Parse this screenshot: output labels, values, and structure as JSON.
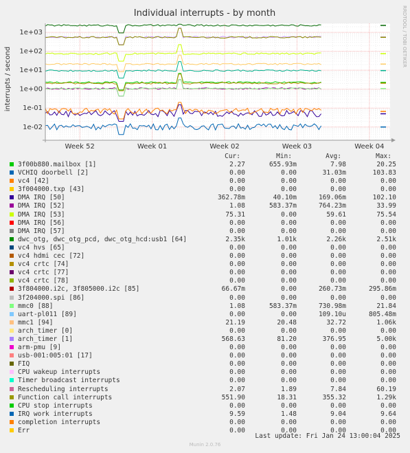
{
  "chart_data": {
    "type": "line",
    "title": "Individual interrupts - by month",
    "ylabel": "interrupts / second",
    "y_scale": "log",
    "ylim": [
      0.002,
      3000
    ],
    "y_ticks": [
      {
        "value": 1000,
        "label": "1e+03"
      },
      {
        "value": 100,
        "label": "1e+02"
      },
      {
        "value": 10,
        "label": "1e+01"
      },
      {
        "value": 1,
        "label": "1e+00"
      },
      {
        "value": 0.1,
        "label": "1e-01"
      },
      {
        "value": 0.01,
        "label": "1e-02"
      }
    ],
    "x_ticks": [
      "Week 52",
      "Week 01",
      "Week 02",
      "Week 03",
      "Week 04"
    ],
    "grid": true,
    "series": [
      {
        "name": "3f00b880.mailbox [1]",
        "color": "#00cc00",
        "level": 2.27
      },
      {
        "name": "VCHIQ doorbell [2]",
        "color": "#0066b3",
        "level": 0.01
      },
      {
        "name": "DMA IRQ [50]",
        "color": "#330099",
        "level": 0.05
      },
      {
        "name": "DMA IRQ [52]",
        "color": "#990099",
        "level": 1.08
      },
      {
        "name": "DMA IRQ [53]",
        "color": "#ccff00",
        "level": 75.31
      },
      {
        "name": "dwc_otg, dwc_otg_pcd, dwc_otg_hcd:usb1 [64]",
        "color": "#006600",
        "level": 2350
      },
      {
        "name": "3f804000.i2c, 3f805000.i2c [85]",
        "color": "#ff8000",
        "level": 0.0667
      },
      {
        "name": "mmc0 [88]",
        "color": "#8fff8f",
        "level": 1.08
      },
      {
        "name": "mmc1 [94]",
        "color": "#ffcc66",
        "level": 21.19
      },
      {
        "name": "arch_timer [1]",
        "color": "#cc99ff",
        "level": 568.63
      },
      {
        "name": "Rescheduling interrupts",
        "color": "#b38f00",
        "level": 2.07
      },
      {
        "name": "Function call interrupts",
        "color": "#8f8f00",
        "level": 551.9
      },
      {
        "name": "IRQ work interrupts",
        "color": "#00b38f",
        "level": 9.59
      }
    ]
  },
  "side_text": "RRDTOOL / TOBI OETIKER",
  "legend_headers": {
    "cur": "Cur:",
    "min": "Min:",
    "avg": "Avg:",
    "max": "Max:"
  },
  "legend": [
    {
      "name": "3f00b880.mailbox [1]",
      "color": "#00cc00",
      "cur": "2.27",
      "min": "655.93m",
      "avg": "7.98",
      "max": "20.25"
    },
    {
      "name": "VCHIQ doorbell [2]",
      "color": "#0066b3",
      "cur": "0.00",
      "min": "0.00",
      "avg": "31.03m",
      "max": "103.83"
    },
    {
      "name": "vc4 [42]",
      "color": "#ff8000",
      "cur": "0.00",
      "min": "0.00",
      "avg": "0.00",
      "max": "0.00"
    },
    {
      "name": "3f004000.txp [43]",
      "color": "#ffcc00",
      "cur": "0.00",
      "min": "0.00",
      "avg": "0.00",
      "max": "0.00"
    },
    {
      "name": "DMA IRQ [50]",
      "color": "#330099",
      "cur": "362.78m",
      "min": "40.10m",
      "avg": "169.06m",
      "max": "102.10"
    },
    {
      "name": "DMA IRQ [52]",
      "color": "#990099",
      "cur": "1.08",
      "min": "583.37m",
      "avg": "764.23m",
      "max": "33.99"
    },
    {
      "name": "DMA IRQ [53]",
      "color": "#ccff00",
      "cur": "75.31",
      "min": "0.00",
      "avg": "59.61",
      "max": "75.54"
    },
    {
      "name": "DMA IRQ [56]",
      "color": "#ff0000",
      "cur": "0.00",
      "min": "0.00",
      "avg": "0.00",
      "max": "0.00"
    },
    {
      "name": "DMA IRQ [57]",
      "color": "#808080",
      "cur": "0.00",
      "min": "0.00",
      "avg": "0.00",
      "max": "0.00"
    },
    {
      "name": "dwc_otg, dwc_otg_pcd, dwc_otg_hcd:usb1 [64]",
      "color": "#008f00",
      "cur": "2.35k",
      "min": "1.01k",
      "avg": "2.26k",
      "max": "2.51k"
    },
    {
      "name": "vc4 hvs [65]",
      "color": "#00487d",
      "cur": "0.00",
      "min": "0.00",
      "avg": "0.00",
      "max": "0.00"
    },
    {
      "name": "vc4 hdmi cec [72]",
      "color": "#b35a00",
      "cur": "0.00",
      "min": "0.00",
      "avg": "0.00",
      "max": "0.00"
    },
    {
      "name": "vc4 crtc [74]",
      "color": "#b38f00",
      "cur": "0.00",
      "min": "0.00",
      "avg": "0.00",
      "max": "0.00"
    },
    {
      "name": "vc4 crtc [77]",
      "color": "#6b006b",
      "cur": "0.00",
      "min": "0.00",
      "avg": "0.00",
      "max": "0.00"
    },
    {
      "name": "vc4 crtc [78]",
      "color": "#8fb300",
      "cur": "0.00",
      "min": "0.00",
      "avg": "0.00",
      "max": "0.00"
    },
    {
      "name": "3f804000.i2c, 3f805000.i2c [85]",
      "color": "#b30000",
      "cur": "66.67m",
      "min": "0.00",
      "avg": "260.73m",
      "max": "295.86m"
    },
    {
      "name": "3f204000.spi [86]",
      "color": "#bebebe",
      "cur": "0.00",
      "min": "0.00",
      "avg": "0.00",
      "max": "0.00"
    },
    {
      "name": "mmc0 [88]",
      "color": "#80ff80",
      "cur": "1.08",
      "min": "583.37m",
      "avg": "730.98m",
      "max": "21.84"
    },
    {
      "name": "uart-pl011 [89]",
      "color": "#80c9ff",
      "cur": "0.00",
      "min": "0.00",
      "avg": "109.10u",
      "max": "805.48m"
    },
    {
      "name": "mmc1 [94]",
      "color": "#ffc080",
      "cur": "21.19",
      "min": "20.48",
      "avg": "32.72",
      "max": "1.06k"
    },
    {
      "name": "arch_timer [0]",
      "color": "#ffe680",
      "cur": "0.00",
      "min": "0.00",
      "avg": "0.00",
      "max": "0.00"
    },
    {
      "name": "arch_timer [1]",
      "color": "#aa80ff",
      "cur": "568.63",
      "min": "81.20",
      "avg": "376.95",
      "max": "5.00k"
    },
    {
      "name": "arm-pmu [9]",
      "color": "#ee00cc",
      "cur": "0.00",
      "min": "0.00",
      "avg": "0.00",
      "max": "0.00"
    },
    {
      "name": "usb-001:005:01 [17]",
      "color": "#ff8080",
      "cur": "0.00",
      "min": "0.00",
      "avg": "0.00",
      "max": "0.00"
    },
    {
      "name": "FIQ",
      "color": "#666600",
      "cur": "0.00",
      "min": "0.00",
      "avg": "0.00",
      "max": "0.00"
    },
    {
      "name": "CPU wakeup interrupts",
      "color": "#ffbfff",
      "cur": "0.00",
      "min": "0.00",
      "avg": "0.00",
      "max": "0.00"
    },
    {
      "name": "Timer broadcast interrupts",
      "color": "#00ffcc",
      "cur": "0.00",
      "min": "0.00",
      "avg": "0.00",
      "max": "0.00"
    },
    {
      "name": "Rescheduling interrupts",
      "color": "#cc6699",
      "cur": "2.07",
      "min": "1.89",
      "avg": "7.84",
      "max": "60.19"
    },
    {
      "name": "Function call interrupts",
      "color": "#999900",
      "cur": "551.90",
      "min": "18.31",
      "avg": "355.32",
      "max": "1.29k"
    },
    {
      "name": "CPU stop interrupts",
      "color": "#00cc00",
      "cur": "0.00",
      "min": "0.00",
      "avg": "0.00",
      "max": "0.00"
    },
    {
      "name": "IRQ work interrupts",
      "color": "#0066b3",
      "cur": "9.59",
      "min": "1.48",
      "avg": "9.04",
      "max": "9.64"
    },
    {
      "name": "completion interrupts",
      "color": "#ff8000",
      "cur": "0.00",
      "min": "0.00",
      "avg": "0.00",
      "max": "0.00"
    },
    {
      "name": "Err",
      "color": "#ffcc00",
      "cur": "0.00",
      "min": "0.00",
      "avg": "0.00",
      "max": "0.00"
    }
  ],
  "last_update": "Last update: Fri Jan 24 13:00:04 2025",
  "footer": "Munin 2.0.76"
}
